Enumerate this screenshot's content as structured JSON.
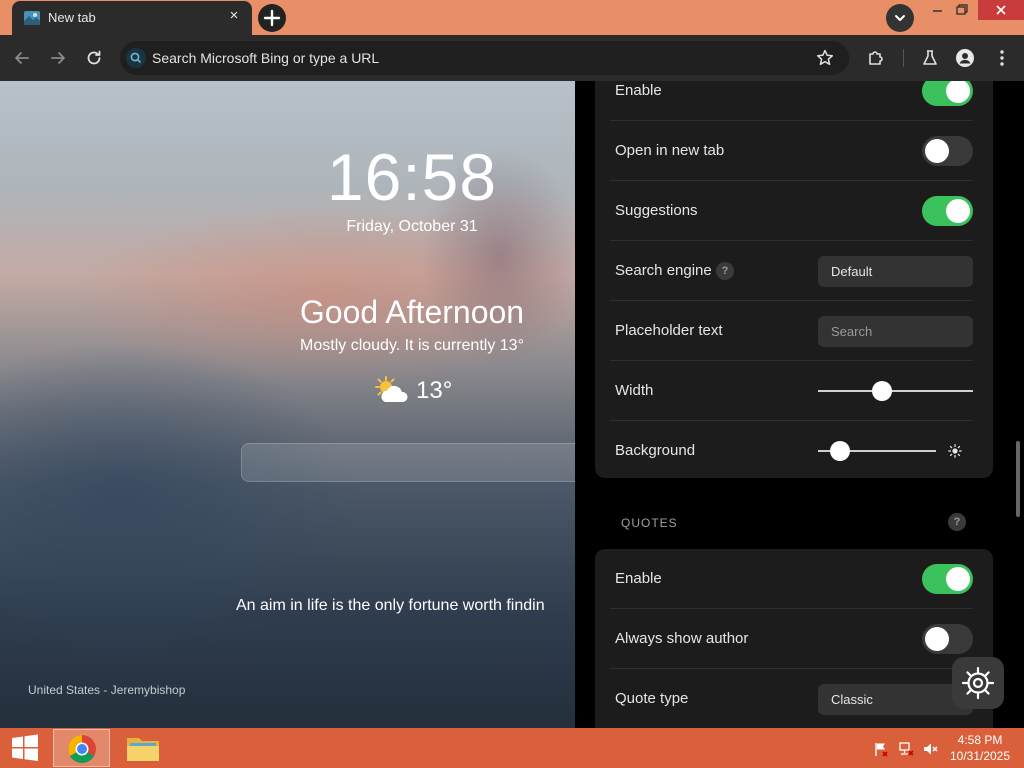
{
  "browser": {
    "tab_title": "New tab",
    "tab_close": "×",
    "omnibox_placeholder": "Search Microsoft Bing or type a URL"
  },
  "page": {
    "clock": "16:58",
    "date": "Friday, October 31",
    "greeting": "Good Afternoon",
    "weather_description": "Mostly cloudy. It is currently 13°",
    "weather_temp": "13°",
    "weather_icon": "partly-cloudy-icon",
    "quote": "An aim in life is the only fortune worth findin",
    "photo_credit": "United States - Jeremybishop"
  },
  "settings": {
    "search_section": {
      "enable_label": "Enable",
      "enable_on": true,
      "open_new_tab_label": "Open in new tab",
      "open_new_tab_on": false,
      "suggestions_label": "Suggestions",
      "suggestions_on": true,
      "search_engine_label": "Search engine",
      "search_engine_help": "?",
      "search_engine_value": "Default",
      "placeholder_label": "Placeholder text",
      "placeholder_hint": "Search",
      "width_label": "Width",
      "width_level": 0.41,
      "background_label": "Background",
      "background_level": 0.19
    },
    "quotes_section": {
      "header": "QUOTES",
      "help": "?",
      "enable_label": "Enable",
      "enable_on": true,
      "always_show_author_label": "Always show author",
      "always_show_author_on": false,
      "quote_type_label": "Quote type",
      "quote_type_value": "Classic"
    }
  },
  "taskbar": {
    "time": "4:58 PM",
    "date": "10/31/2025"
  },
  "colors": {
    "toggle_on": "#3bc25c",
    "toggle_off": "#3a3a3a",
    "titlebar": "#e98f68",
    "taskbar": "#d9603a",
    "close_button": "#c83c3c"
  }
}
